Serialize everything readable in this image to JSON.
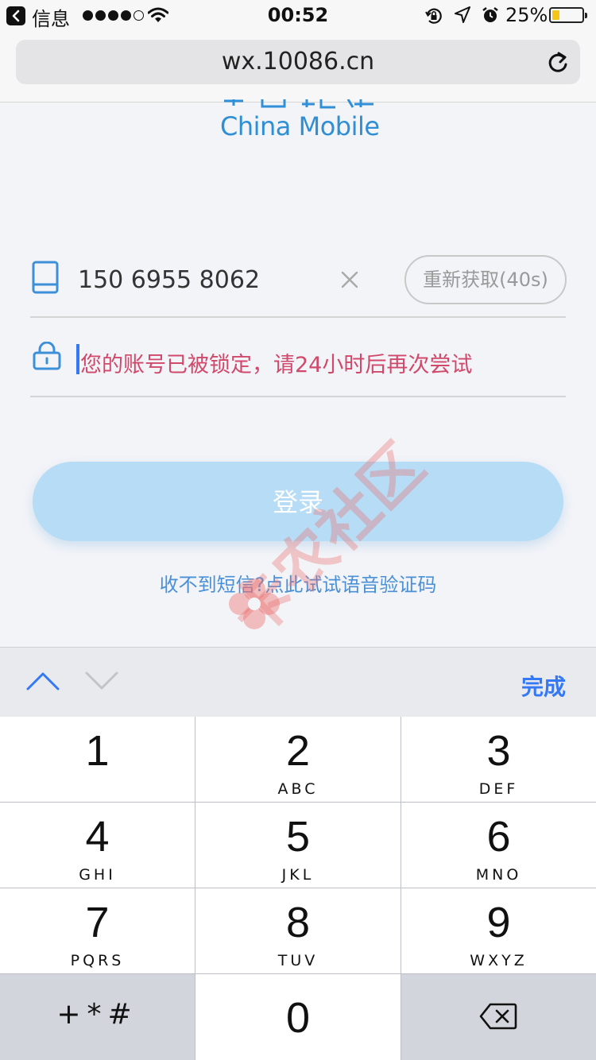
{
  "status_bar": {
    "back_app": "信息",
    "time": "00:52",
    "battery": "25%",
    "battery_level": 0.25,
    "signal_bars": 4,
    "icons": [
      "back-icon",
      "signal-dots-icon",
      "wifi-icon",
      "rotation-lock-icon",
      "location-icon",
      "alarm-icon",
      "battery-icon"
    ]
  },
  "browser": {
    "url": "wx.10086.cn",
    "reload_icon": "reload-icon"
  },
  "logo": {
    "text": "China Mobile",
    "color": "#2e8fd5"
  },
  "form": {
    "phone_value": "150 6955 8062",
    "resend_label": "重新获取(40s)",
    "password_placeholder": "您的账号已被锁定，请24小时后再次尝试",
    "login_label": "登录",
    "voice_code_link": "收不到短信?点此试试语音验证码"
  },
  "watermark": {
    "text": "卡农社区"
  },
  "keyboard_accessory": {
    "done_label": "完成"
  },
  "keypad": {
    "keys": [
      {
        "num": "1",
        "letters": ""
      },
      {
        "num": "2",
        "letters": "ABC"
      },
      {
        "num": "3",
        "letters": "DEF"
      },
      {
        "num": "4",
        "letters": "GHI"
      },
      {
        "num": "5",
        "letters": "JKL"
      },
      {
        "num": "6",
        "letters": "MNO"
      },
      {
        "num": "7",
        "letters": "PQRS"
      },
      {
        "num": "8",
        "letters": "TUV"
      },
      {
        "num": "9",
        "letters": "WXYZ"
      }
    ],
    "symbols": "+*#",
    "zero": "0"
  },
  "colors": {
    "accent": "#3478f6",
    "link": "#4a90d6",
    "error_text": "#d0496b",
    "login_button": "#b6dcf6"
  }
}
